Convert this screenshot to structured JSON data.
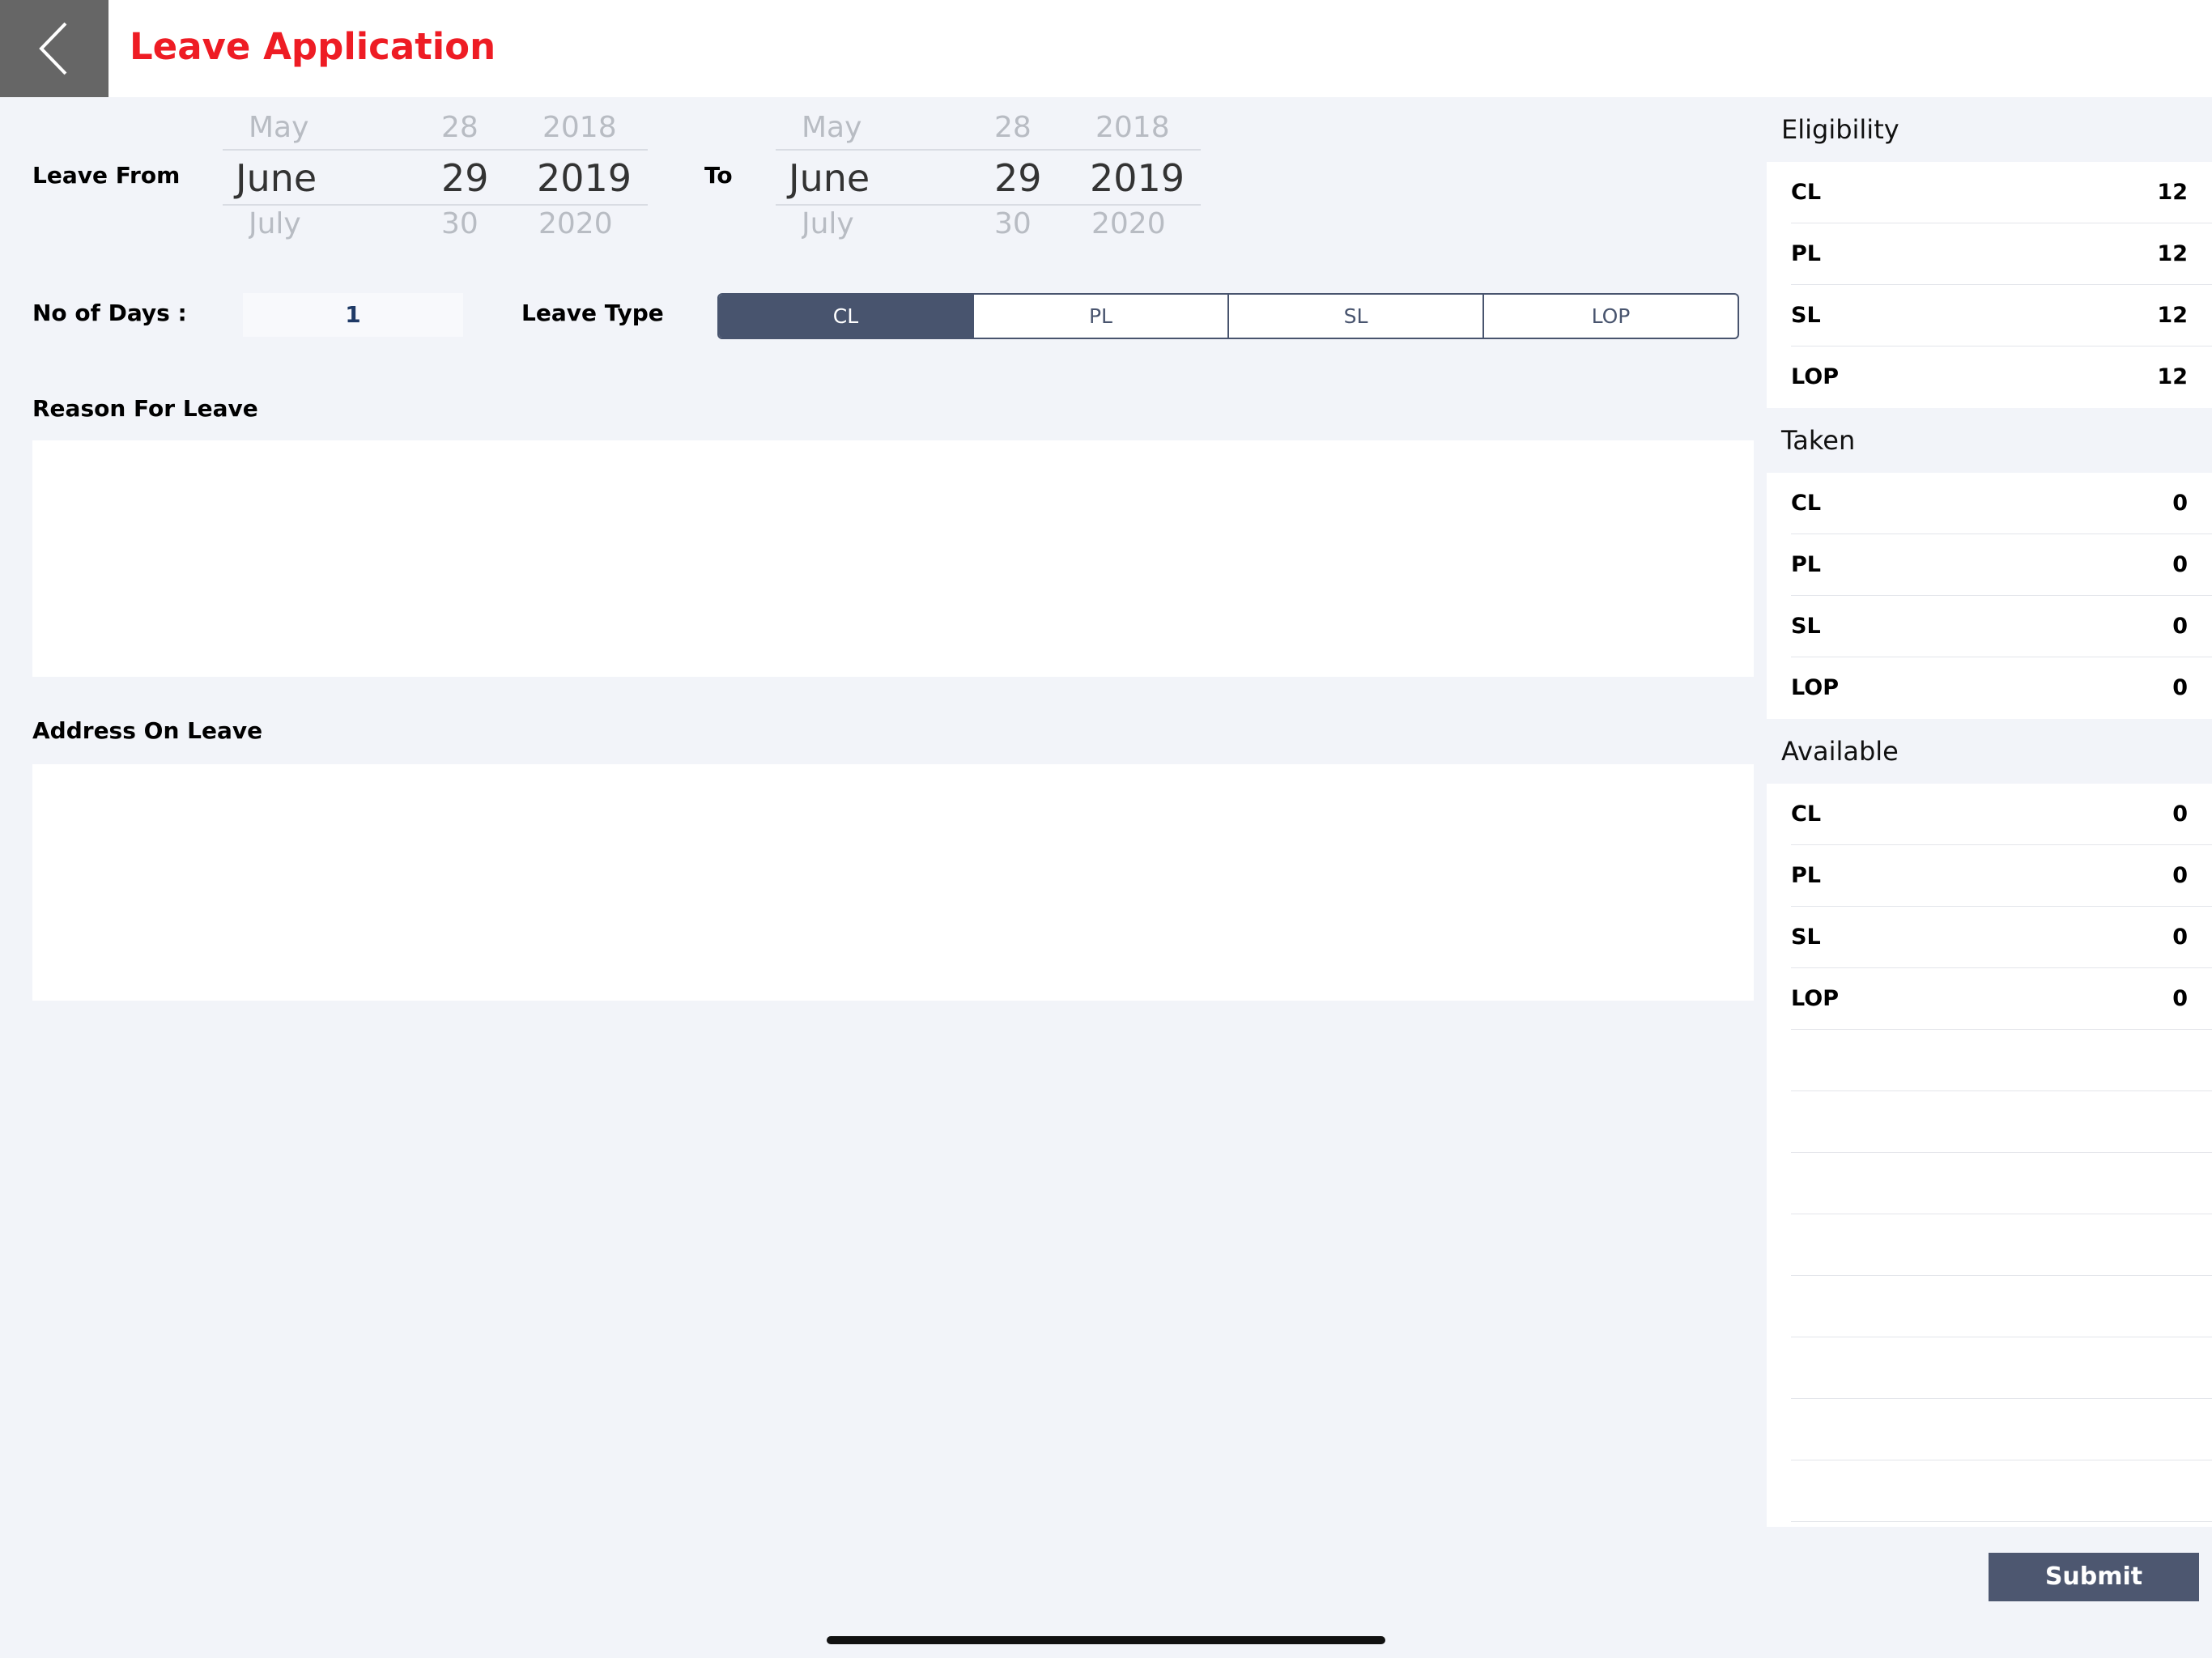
{
  "header": {
    "title": "Leave Application"
  },
  "form": {
    "leave_from_label": "Leave From",
    "to_label": "To",
    "no_of_days_label": "No of Days :",
    "no_of_days_value": "1",
    "leave_type_label": "Leave Type",
    "leave_types": [
      "CL",
      "PL",
      "SL",
      "LOP"
    ],
    "selected_leave_type": "CL",
    "reason_label": "Reason For Leave",
    "reason_value": "",
    "address_label": "Address On Leave",
    "address_value": ""
  },
  "from_picker": {
    "prev": {
      "month": "May",
      "day": "28",
      "year": "2018"
    },
    "current": {
      "month": "June",
      "day": "29",
      "year": "2019"
    },
    "next": {
      "month": "July",
      "day": "30",
      "year": "2020"
    }
  },
  "to_picker": {
    "prev": {
      "month": "May",
      "day": "28",
      "year": "2018"
    },
    "current": {
      "month": "June",
      "day": "29",
      "year": "2019"
    },
    "next": {
      "month": "July",
      "day": "30",
      "year": "2020"
    }
  },
  "summary": {
    "eligibility": {
      "title": "Eligibility",
      "rows": [
        {
          "label": "CL",
          "value": "12"
        },
        {
          "label": "PL",
          "value": "12"
        },
        {
          "label": "SL",
          "value": "12"
        },
        {
          "label": "LOP",
          "value": "12"
        }
      ]
    },
    "taken": {
      "title": "Taken",
      "rows": [
        {
          "label": "CL",
          "value": "0"
        },
        {
          "label": "PL",
          "value": "0"
        },
        {
          "label": "SL",
          "value": "0"
        },
        {
          "label": "LOP",
          "value": "0"
        }
      ]
    },
    "available": {
      "title": "Available",
      "rows": [
        {
          "label": "CL",
          "value": "0"
        },
        {
          "label": "PL",
          "value": "0"
        },
        {
          "label": "SL",
          "value": "0"
        },
        {
          "label": "LOP",
          "value": "0"
        }
      ]
    }
  },
  "actions": {
    "submit_label": "Submit"
  },
  "colors": {
    "title_red": "#ee1c24",
    "segment_active": "#48546e",
    "submit_bg": "#4d5770",
    "page_bg": "#f2f4f9"
  },
  "icons": {
    "back": "chevron-left-icon"
  }
}
